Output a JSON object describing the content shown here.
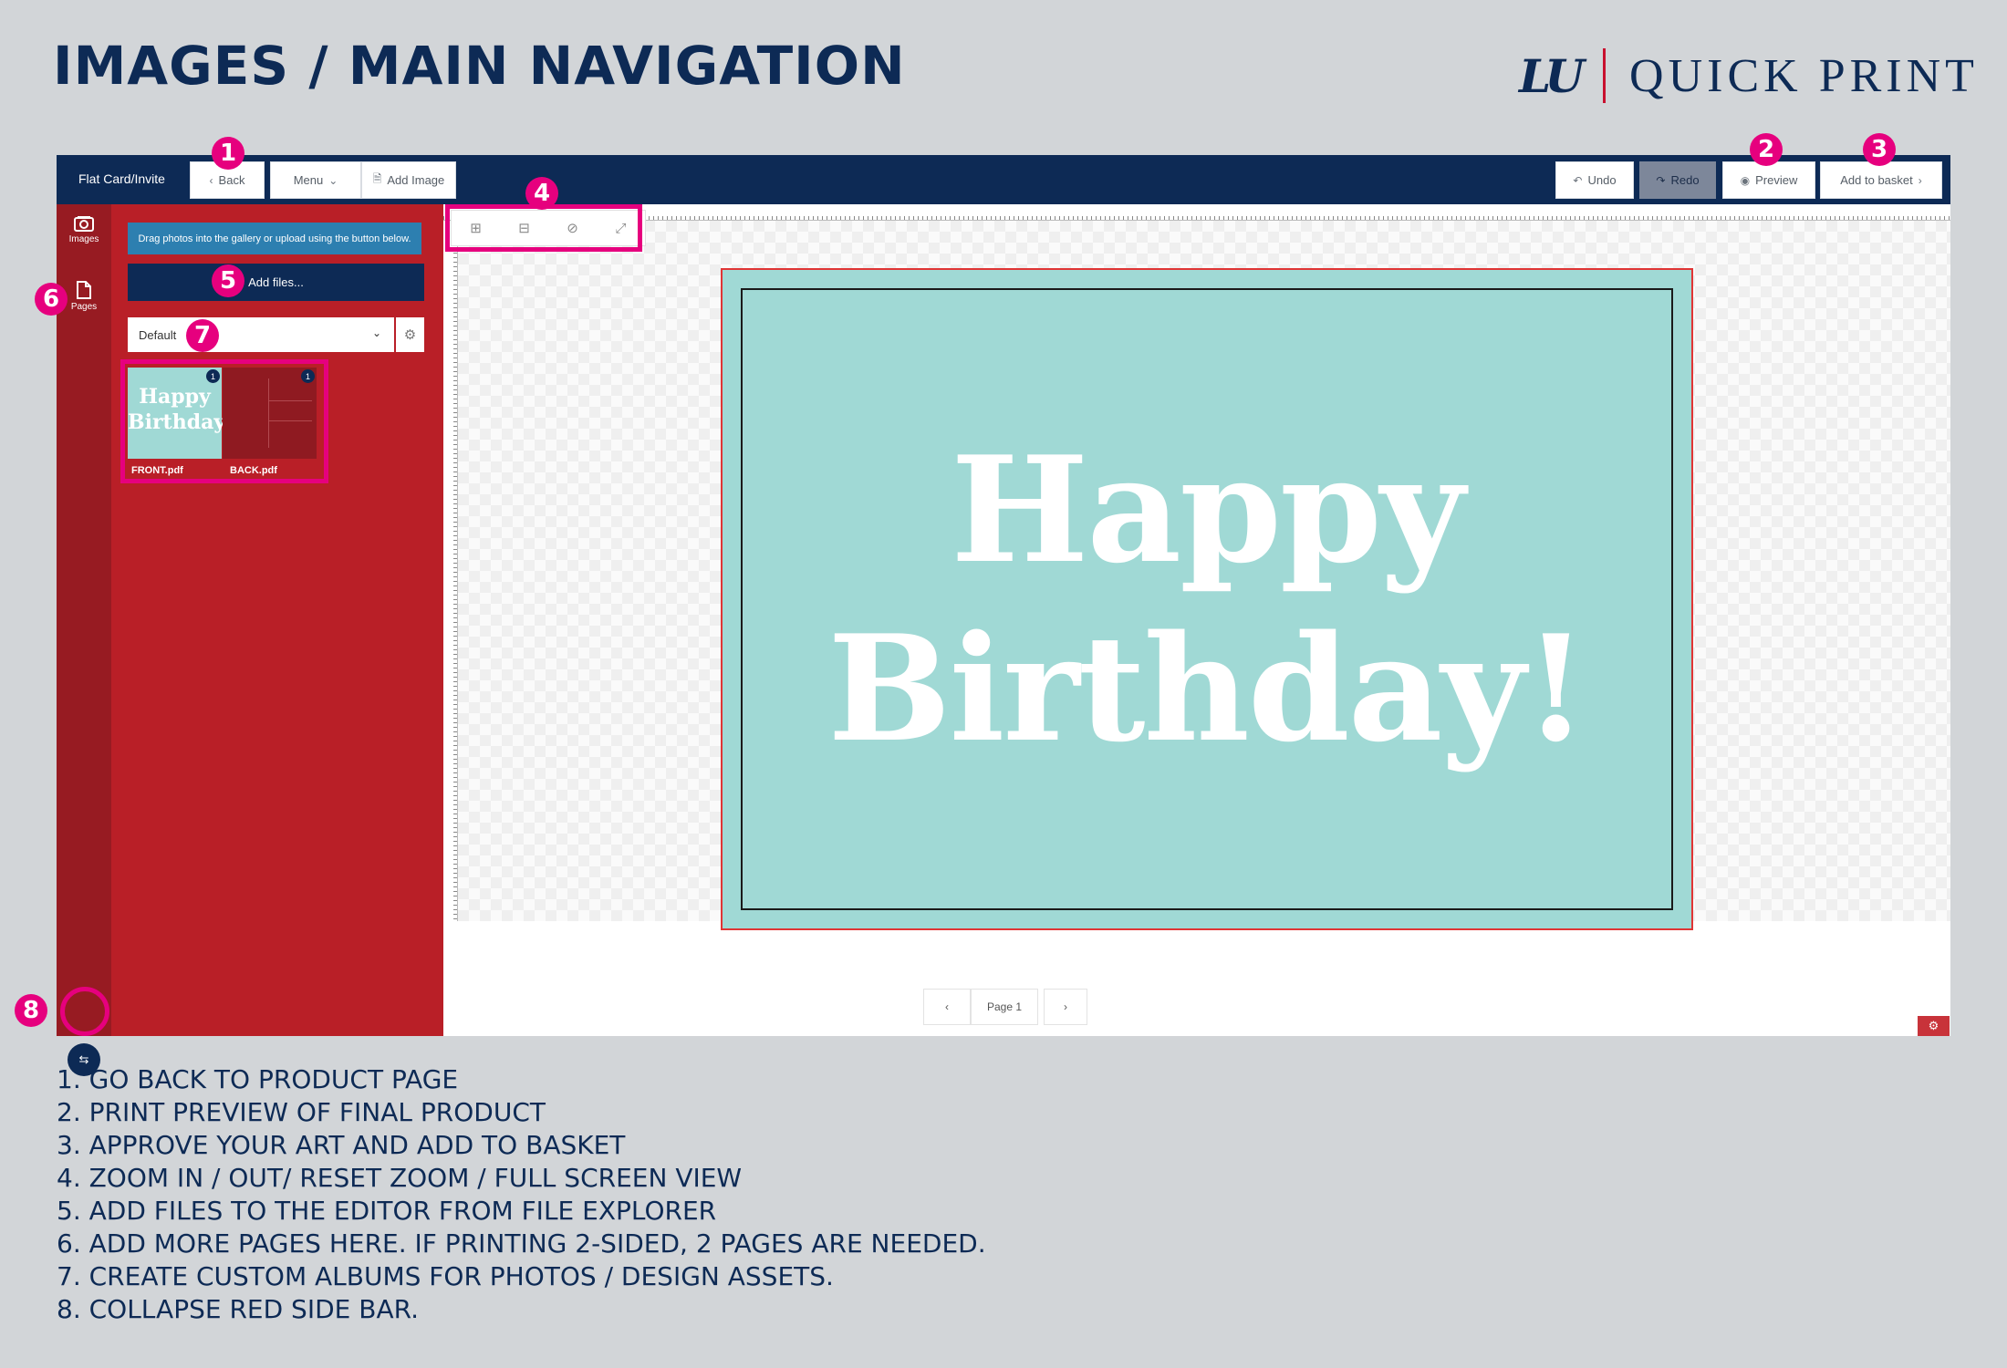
{
  "header": {
    "title": "IMAGES / MAIN NAVIGATION",
    "brand_logo": "LU",
    "brand_name": "QUICK PRINT"
  },
  "toolbar": {
    "product_name": "Flat Card/Invite",
    "back_label": "Back",
    "menu_label": "Menu",
    "add_image_label": "Add Image",
    "undo_label": "Undo",
    "redo_label": "Redo",
    "preview_label": "Preview",
    "add_to_basket_label": "Add to basket"
  },
  "rail": {
    "items": [
      {
        "label": "Images",
        "icon": "images-icon"
      },
      {
        "label": "Pages",
        "icon": "pages-icon"
      }
    ],
    "collapse_icon": "collapse-arrows-icon"
  },
  "panel": {
    "info_text": "Drag photos into the gallery or upload using the button below.",
    "add_files_label": "Add files...",
    "album_selected": "Default",
    "thumbnails": [
      {
        "name": "FRONT.pdf",
        "badge": "1",
        "preview_text": "Happy Birthday!"
      },
      {
        "name": "BACK.pdf",
        "badge": "1"
      }
    ]
  },
  "canvas": {
    "card_line_1": "Happy",
    "card_line_2": "Birthday!",
    "card_color": "#a0d9d5",
    "bleed_color": "#e03535"
  },
  "pager": {
    "page_label": "Page 1",
    "prev_icon": "chevron-left-icon",
    "next_icon": "chevron-right-icon"
  },
  "callouts": [
    "1",
    "2",
    "3",
    "4",
    "5",
    "6",
    "7",
    "8"
  ],
  "legend": [
    "1. GO BACK TO PRODUCT PAGE",
    "2. PRINT PREVIEW OF FINAL PRODUCT",
    "3. APPROVE YOUR ART AND ADD TO BASKET",
    "4. ZOOM IN / OUT/ RESET ZOOM / FULL SCREEN VIEW",
    "5. ADD FILES TO THE EDITOR FROM FILE EXPLORER",
    "6. ADD MORE PAGES HERE. IF PRINTING 2-SIDED, 2 PAGES ARE NEEDED.",
    "7. CREATE CUSTOM ALBUMS FOR PHOTOS / DESIGN ASSETS.",
    "8. COLLAPSE RED SIDE BAR."
  ],
  "colors": {
    "navy": "#0d2a55",
    "red_panel": "#b91f27",
    "callout_pink": "#e6007e",
    "background": "#d2d5d8"
  }
}
